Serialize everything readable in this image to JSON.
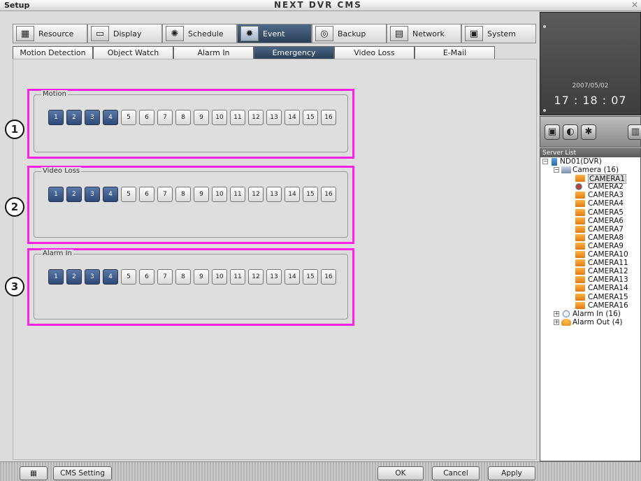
{
  "window": {
    "title": "Setup",
    "app_title": "NEXT DVR CMS",
    "close_glyph": "✕"
  },
  "main_tabs": [
    {
      "label": "Resource",
      "icon": "resource-icon",
      "glyph": "▦"
    },
    {
      "label": "Display",
      "icon": "display-icon",
      "glyph": "▭"
    },
    {
      "label": "Schedule",
      "icon": "schedule-icon",
      "glyph": "✺"
    },
    {
      "label": "Event",
      "icon": "event-icon",
      "glyph": "✹",
      "active": true
    },
    {
      "label": "Backup",
      "icon": "backup-icon",
      "glyph": "◎"
    },
    {
      "label": "Network",
      "icon": "network-icon",
      "glyph": "▤"
    },
    {
      "label": "System",
      "icon": "system-icon",
      "glyph": "▣"
    }
  ],
  "sub_tabs": [
    {
      "label": "Motion Detection"
    },
    {
      "label": "Object Watch"
    },
    {
      "label": "Alarm In"
    },
    {
      "label": "Emergency",
      "active": true
    },
    {
      "label": "Video Loss"
    },
    {
      "label": "E-Mail"
    }
  ],
  "groups": [
    {
      "callout": "1",
      "legend": "Motion",
      "channels": [
        "1",
        "2",
        "3",
        "4",
        "5",
        "6",
        "7",
        "8",
        "9",
        "10",
        "11",
        "12",
        "13",
        "14",
        "15",
        "16"
      ],
      "selected_count": 4
    },
    {
      "callout": "2",
      "legend": "Video Loss",
      "channels": [
        "1",
        "2",
        "3",
        "4",
        "5",
        "6",
        "7",
        "8",
        "9",
        "10",
        "11",
        "12",
        "13",
        "14",
        "15",
        "16"
      ],
      "selected_count": 4
    },
    {
      "callout": "3",
      "legend": "Alarm In",
      "channels": [
        "1",
        "2",
        "3",
        "4",
        "5",
        "6",
        "7",
        "8",
        "9",
        "10",
        "11",
        "12",
        "13",
        "14",
        "15",
        "16"
      ],
      "selected_count": 4
    }
  ],
  "clock": {
    "date": "2007/05/02",
    "time": "17 : 18 : 07"
  },
  "toolbar_icons": [
    "monitor-icon",
    "search-icon",
    "gear-icon",
    "layout-icon"
  ],
  "server_list": {
    "header": "Server List",
    "dvr": "ND01(DVR)",
    "camera_group": "Camera (16)",
    "cameras": [
      "CAMERA1",
      "CAMERA2",
      "CAMERA3",
      "CAMERA4",
      "CAMERA5",
      "CAMERA6",
      "CAMERA7",
      "CAMERA8",
      "CAMERA9",
      "CAMERA10",
      "CAMERA11",
      "CAMERA12",
      "CAMERA13",
      "CAMERA14",
      "CAMERA15",
      "CAMERA16"
    ],
    "alarm_in": "Alarm In (16)",
    "alarm_out": "Alarm Out (4)",
    "expanded_glyph": "−",
    "collapsed_glyph": "+"
  },
  "bottom": {
    "cms_setting": "CMS Setting",
    "ok": "OK",
    "cancel": "Cancel",
    "apply": "Apply"
  },
  "colors": {
    "highlight_box": "#ff22e6",
    "selected_channel": "#2f4a78",
    "active_tab": "#2b3f58"
  }
}
